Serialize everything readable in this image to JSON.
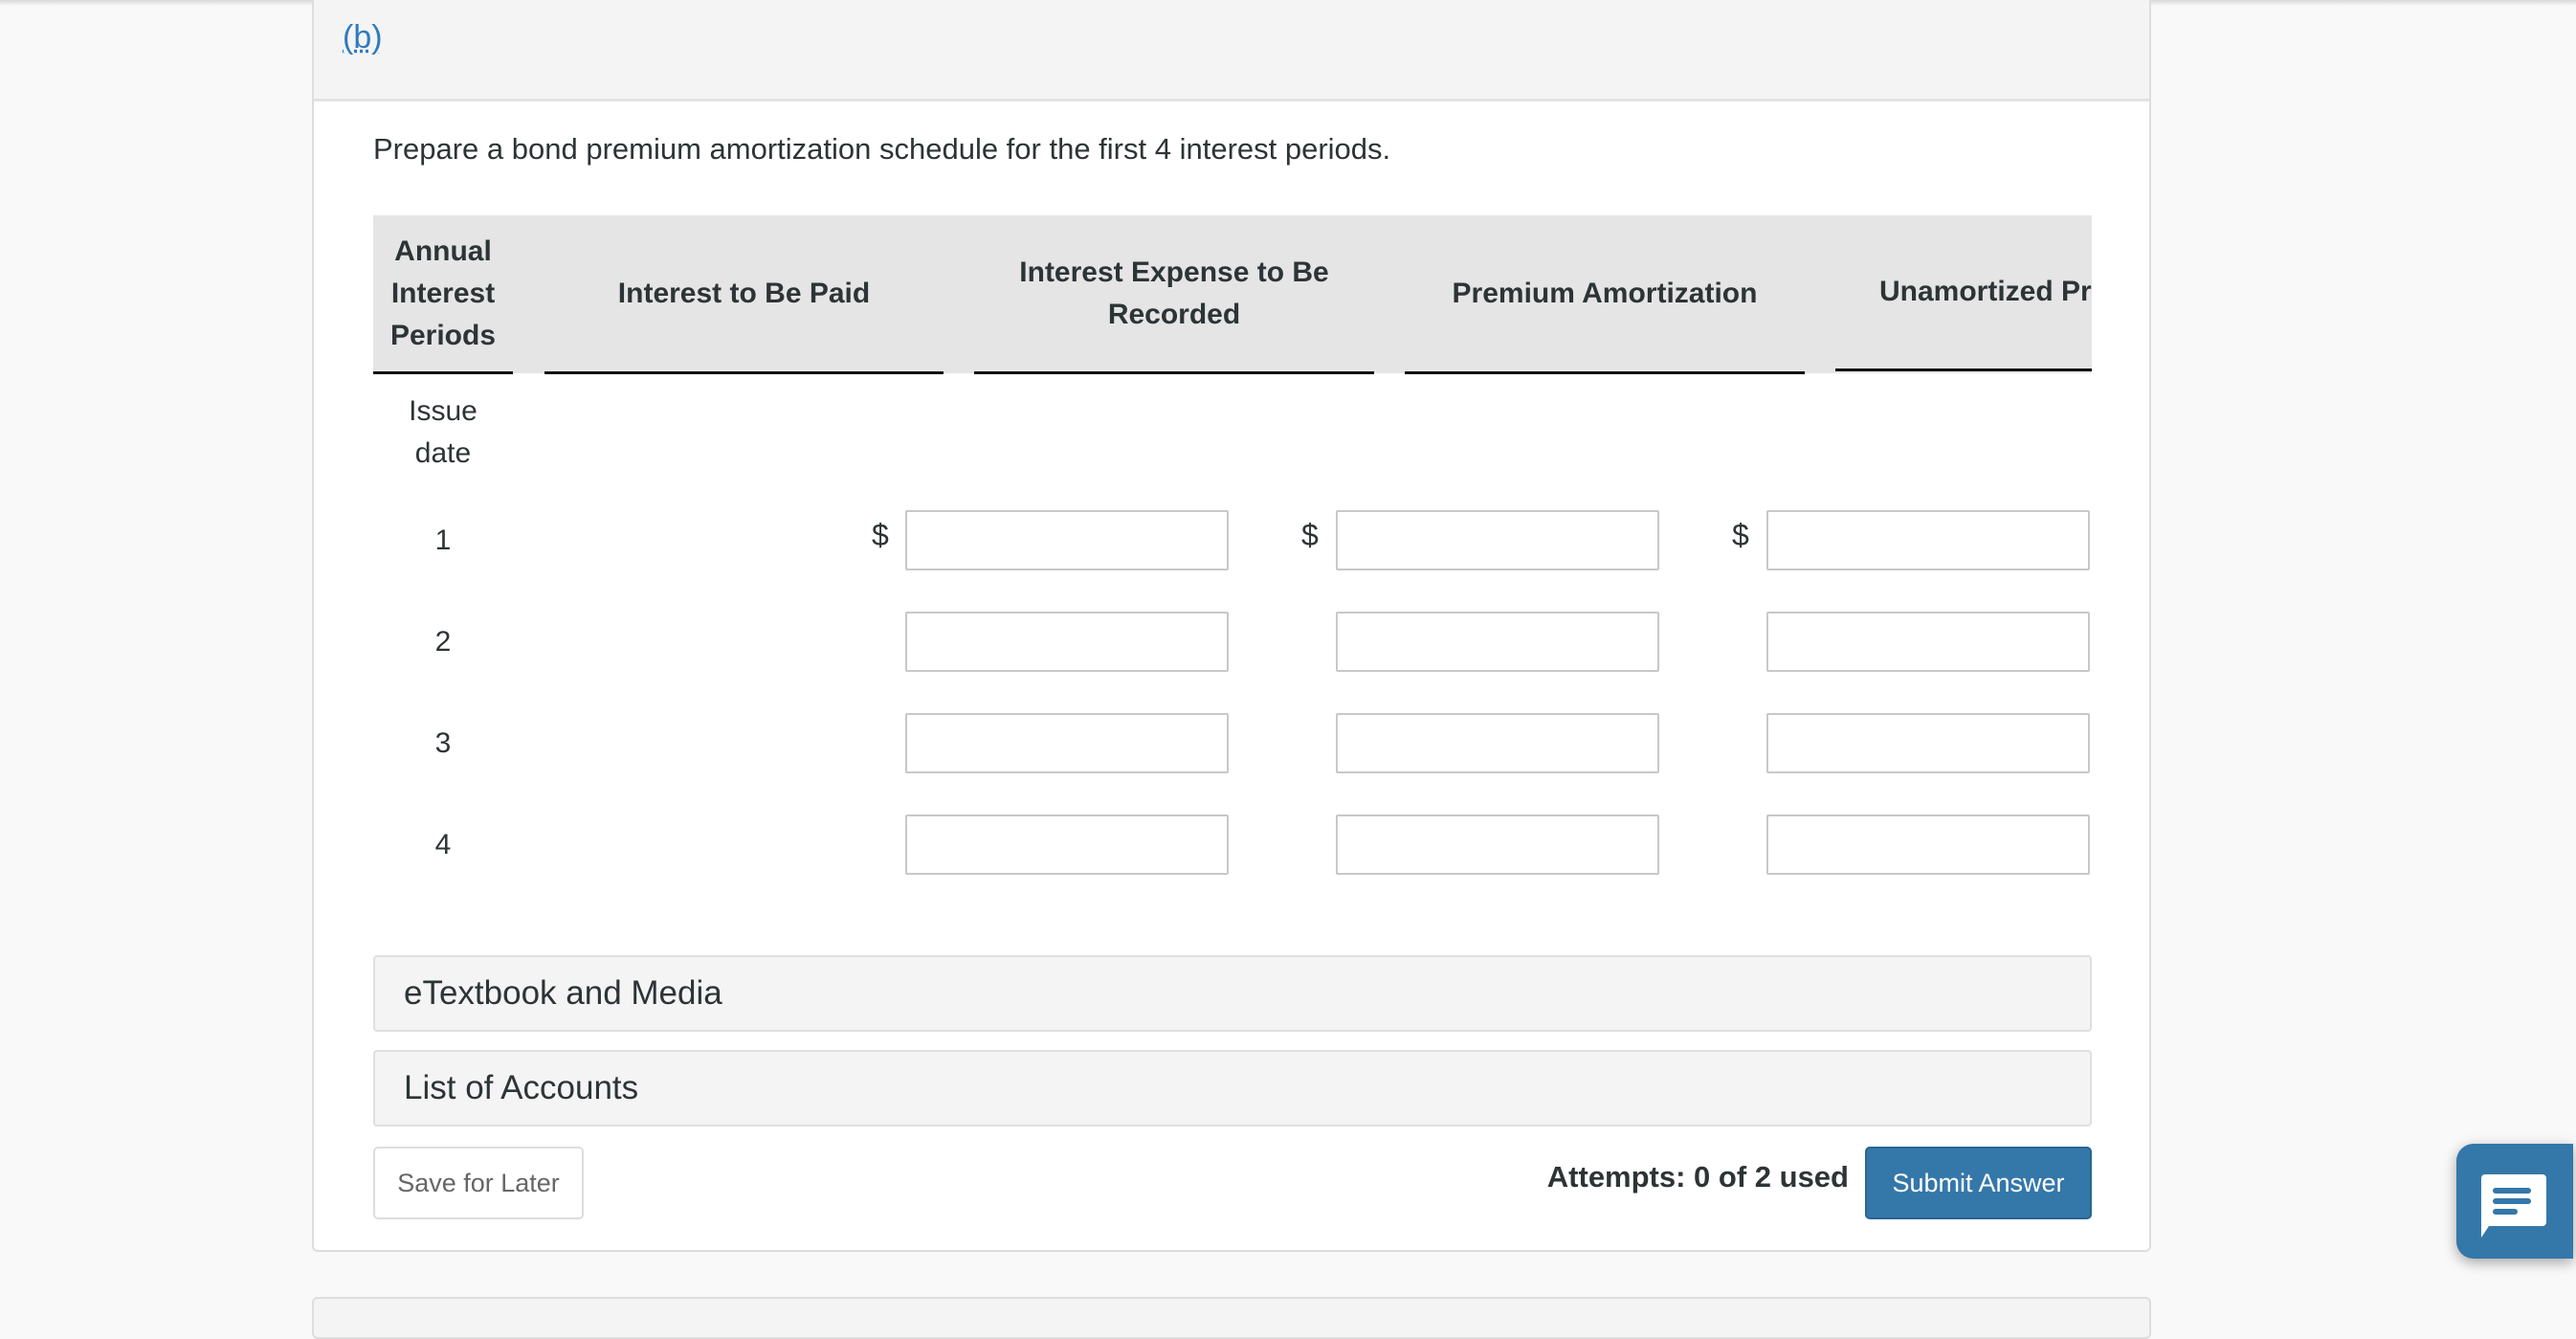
{
  "part_label": "(b)",
  "prompt": "Prepare a bond premium amortization schedule for the first 4 interest periods.",
  "table": {
    "headers": [
      "Annual Interest Periods",
      "Interest to Be Paid",
      "Interest Expense to Be Recorded",
      "Premium Amortization",
      "Unamortized Pr"
    ],
    "header_lines": {
      "col0": [
        "Annual",
        "Interest",
        "Periods"
      ],
      "col2": [
        "Interest Expense to Be",
        "Recorded"
      ]
    },
    "currency_symbol": "$",
    "rows": [
      {
        "label_lines": [
          "Issue",
          "date"
        ]
      },
      {
        "label": "1"
      },
      {
        "label": "2"
      },
      {
        "label": "3"
      },
      {
        "label": "4"
      }
    ]
  },
  "accordions": [
    "eTextbook and Media",
    "List of Accounts"
  ],
  "footer": {
    "save_label": "Save for Later",
    "attempts": "Attempts: 0 of 2 used",
    "submit_label": "Submit Answer"
  },
  "colors": {
    "accent": "#3477a9",
    "link": "#2f7bbd",
    "header_bg": "#e5e5e5"
  },
  "icons": {
    "chat": "chat-bubble-icon"
  }
}
